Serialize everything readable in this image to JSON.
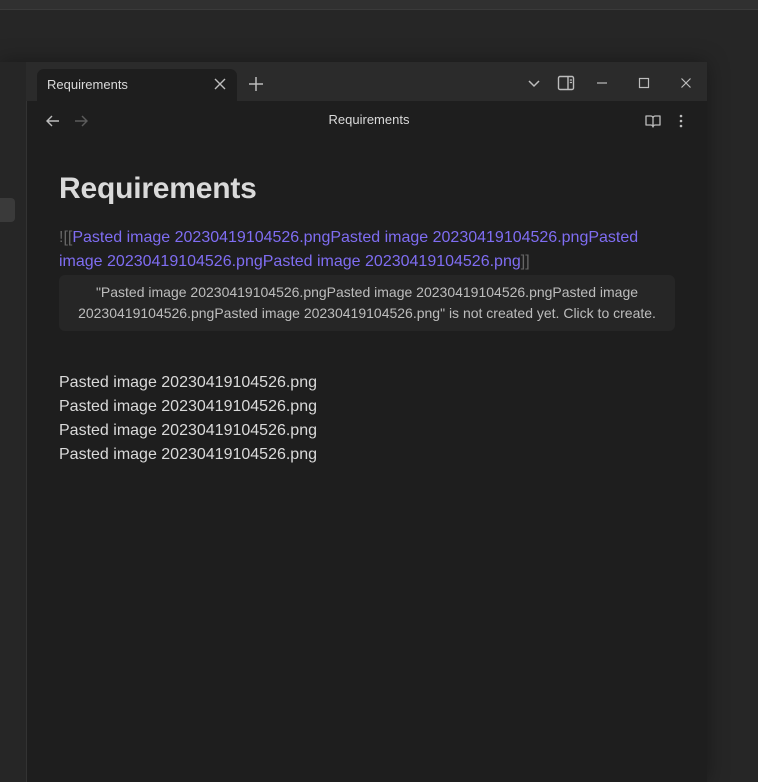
{
  "tab": {
    "title": "Requirements"
  },
  "header": {
    "title": "Requirements"
  },
  "note": {
    "title": "Requirements",
    "link_open": "![[",
    "link_text": "Pasted image 20230419104526.pngPasted image 20230419104526.pngPasted image 20230419104526.pngPasted image 20230419104526.png",
    "link_close": "]]",
    "tooltip": "\"Pasted image 20230419104526.pngPasted image 20230419104526.pngPasted image 20230419104526.pngPasted image 20230419104526.png\" is not created yet. Click to create.",
    "lines": [
      "Pasted image 20230419104526.png",
      "Pasted image 20230419104526.png",
      "Pasted image 20230419104526.png",
      "Pasted image 20230419104526.png"
    ]
  },
  "icons": {
    "new_tab": "plus-icon",
    "tab_close": "close-icon",
    "tab_list": "chevron-down-icon",
    "sidebar_toggle": "sidebar-icon",
    "minimize": "minimize-icon",
    "maximize": "maximize-icon",
    "close": "close-icon",
    "back": "arrow-left-icon",
    "forward": "arrow-right-icon",
    "reading_mode": "book-open-icon",
    "more": "more-vertical-icon"
  },
  "colors": {
    "accent": "#7f6df2",
    "background": "#1e1e1e",
    "text": "#dadada"
  }
}
